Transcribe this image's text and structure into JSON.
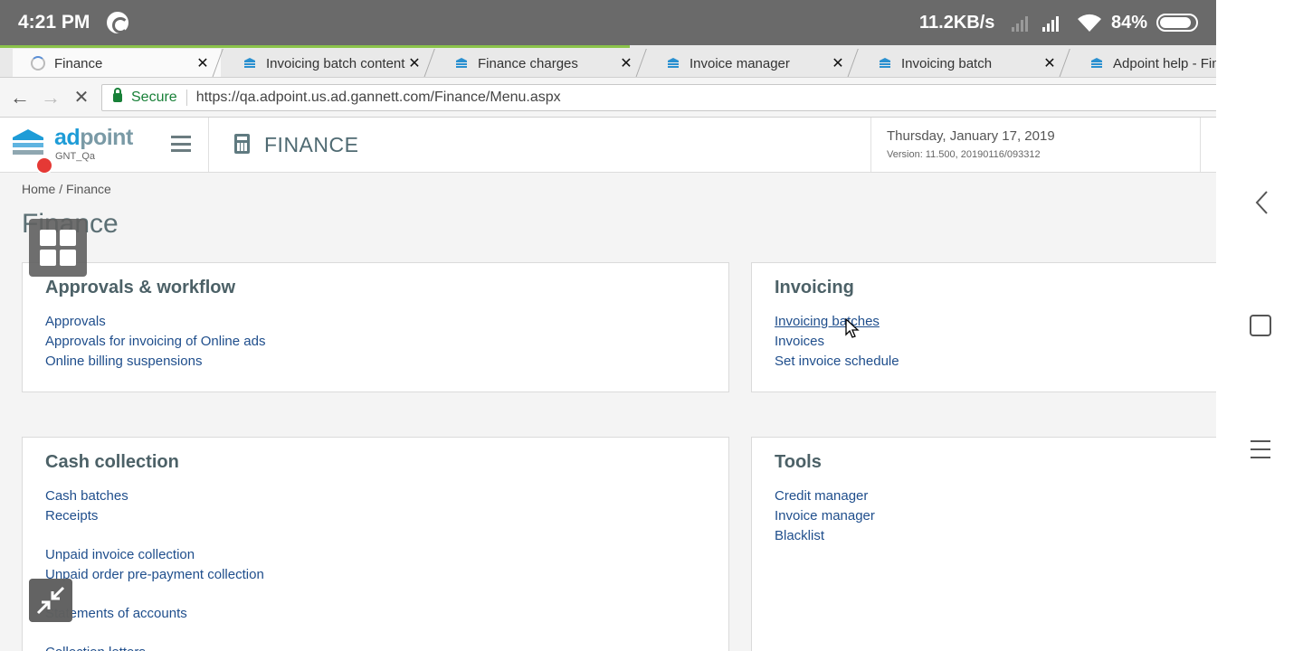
{
  "status_bar": {
    "time": "4:21 PM",
    "net_speed": "11.2KB/s",
    "battery": "84%"
  },
  "browser": {
    "tabs": [
      {
        "title": "Finance",
        "active": true,
        "favicon": "loading-spinner-icon"
      },
      {
        "title": "Invoicing batch content",
        "active": false,
        "favicon": "adpoint-favicon"
      },
      {
        "title": "Finance charges",
        "active": false,
        "favicon": "adpoint-favicon"
      },
      {
        "title": "Invoice manager",
        "active": false,
        "favicon": "adpoint-favicon"
      },
      {
        "title": "Invoicing batch",
        "active": false,
        "favicon": "adpoint-favicon"
      },
      {
        "title": "Adpoint help - Fina",
        "active": false,
        "favicon": "adpoint-favicon"
      }
    ],
    "secure_label": "Secure",
    "url": "https://qa.adpoint.us.ad.gannett.com/Finance/Menu.aspx"
  },
  "header": {
    "logo_ad": "ad",
    "logo_point": "point",
    "environment": "GNT_Qa",
    "module": "FINANCE",
    "date": "Thursday, January 17, 2019",
    "version": "Version: 11.500, 20190116/093312"
  },
  "breadcrumb": "Home  /  Finance",
  "page_title": "Finance",
  "cards": {
    "approvals": {
      "title": "Approvals & workflow",
      "links": [
        "Approvals",
        "Approvals for invoicing of Online ads",
        "Online billing suspensions"
      ]
    },
    "invoicing": {
      "title": "Invoicing",
      "links": [
        "Invoicing batches",
        "Invoices",
        "Set invoice schedule"
      ]
    },
    "cash": {
      "title": "Cash collection",
      "links": [
        "Cash batches",
        "Receipts",
        "Unpaid invoice collection",
        "Unpaid order pre-payment collection",
        "Statements of accounts",
        "Collection letters"
      ]
    },
    "tools": {
      "title": "Tools",
      "links": [
        "Credit manager",
        "Invoice manager",
        "Blacklist"
      ]
    }
  },
  "colors": {
    "status_bar": "#6a6a6a",
    "link": "#1f4e8c",
    "brand_blue": "#1e9cd7",
    "heading": "#4c6167",
    "page_bg": "#f4f4f4"
  }
}
